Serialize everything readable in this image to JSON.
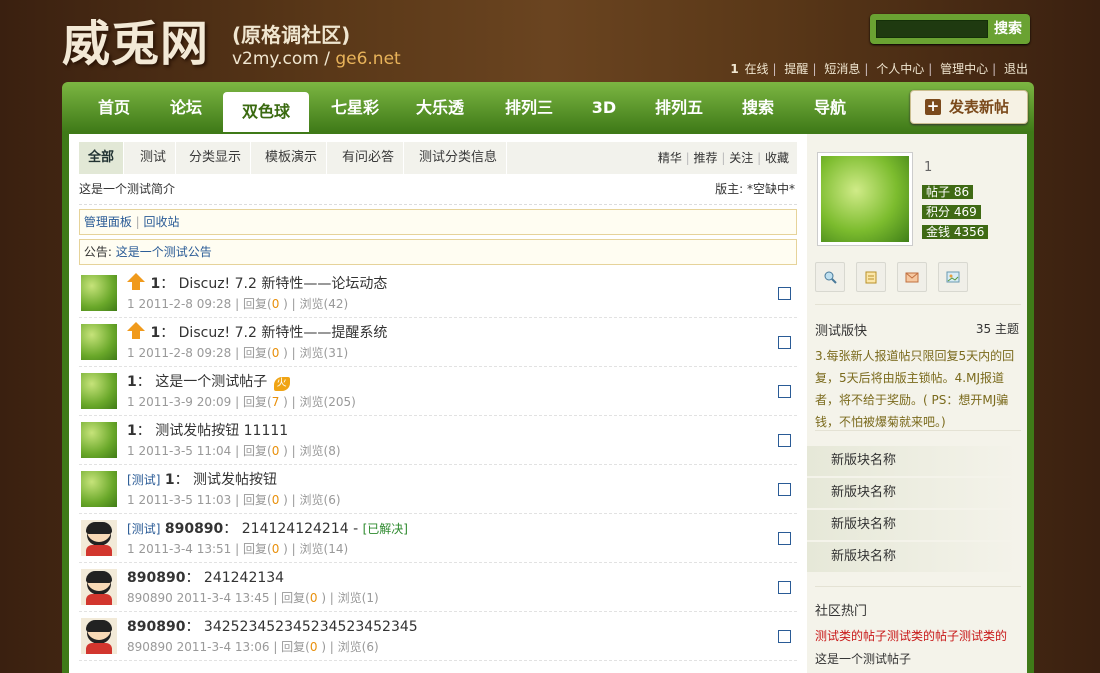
{
  "logo": {
    "main": "威兎网",
    "sub": "(原格调社区)",
    "domain": "v2my.com / ",
    "domain_alt": "ge6.net"
  },
  "search": {
    "button_label": "搜索",
    "placeholder": ""
  },
  "userbar": {
    "online_count": "1",
    "online_label": "在线",
    "remind": "提醒",
    "messages": "短消息",
    "profile": "个人中心",
    "admin": "管理中心",
    "logout": "退出"
  },
  "nav": {
    "items": [
      "首页",
      "论坛",
      "双色球",
      "七星彩",
      "大乐透",
      "排列三",
      "3D",
      "排列五",
      "搜索",
      "导航"
    ],
    "active_index": 2
  },
  "post_button": {
    "label": "发表新帖"
  },
  "subtabs": {
    "items": [
      "全部",
      "测试",
      "分类显示",
      "模板演示",
      "有问必答",
      "测试分类信息"
    ],
    "right": [
      "精华",
      "推荐",
      "关注",
      "收藏"
    ]
  },
  "forum": {
    "description": "这是一个测试简介",
    "moderator": "版主: *空缺中*"
  },
  "admin_bar": {
    "panel": "管理面板",
    "recycle": "回收站"
  },
  "announcement": {
    "label": "公告: ",
    "text": "这是一个测试公告"
  },
  "threads": [
    {
      "pinned": true,
      "author": "1",
      "title": "Discuz! 7.2 新特性——论坛动态",
      "date": "1 2011-2-8 09:28",
      "replies": "0",
      "views": "42",
      "avatar": "leaf"
    },
    {
      "pinned": true,
      "author": "1",
      "title": "Discuz! 7.2 新特性——提醒系统",
      "date": "1 2011-2-8 09:28",
      "replies": "0",
      "views": "31",
      "avatar": "leaf"
    },
    {
      "author": "1",
      "title": "这是一个测试帖子",
      "hot": "火",
      "date": "1 2011-3-9 20:09",
      "replies": "7",
      "views": "205",
      "avatar": "leaf"
    },
    {
      "author": "1",
      "title": "测试发帖按钮 11111",
      "date": "1 2011-3-5 11:04",
      "replies": "0",
      "views": "8",
      "avatar": "leaf"
    },
    {
      "tag": "测试",
      "author": "1",
      "title": "测试发帖按钮",
      "date": "1 2011-3-5 11:03",
      "replies": "0",
      "views": "6",
      "avatar": "leaf"
    },
    {
      "tag": "测试",
      "author": "890890",
      "title": "214124124214",
      "solved": "[已解决]",
      "date": "1 2011-3-4 13:51",
      "replies": "0",
      "views": "14",
      "avatar": "face"
    },
    {
      "author": "890890",
      "title": "241242134",
      "date": "890890 2011-3-4 13:45",
      "replies": "0",
      "views": "1",
      "avatar": "face"
    },
    {
      "author": "890890",
      "title": "342523452345234523452345",
      "date": "890890 2011-3-4 13:06",
      "replies": "0",
      "views": "6",
      "avatar": "face"
    }
  ],
  "meta_labels": {
    "reply": "回复(",
    "view": "浏览("
  },
  "profile": {
    "name": "1",
    "stats": [
      "帖子 86",
      "积分 469",
      "金钱 4356"
    ]
  },
  "forum_info": {
    "title": "测试版快",
    "count": "35 主题",
    "rules": "3.每张新人报道帖只限回复5天内的回复，5天后将由版主锁帖。4.MJ报道者，将不给于奖励。( PS：想开MJ骗钱，不怕被爆菊就来吧。)"
  },
  "side_nav": [
    "新版块名称",
    "新版块名称",
    "新版块名称",
    "新版块名称"
  ],
  "hot": {
    "title": "社区热门",
    "items": [
      "测试类的帖子测试类的帖子测试类的",
      "这是一个测试帖子"
    ]
  }
}
